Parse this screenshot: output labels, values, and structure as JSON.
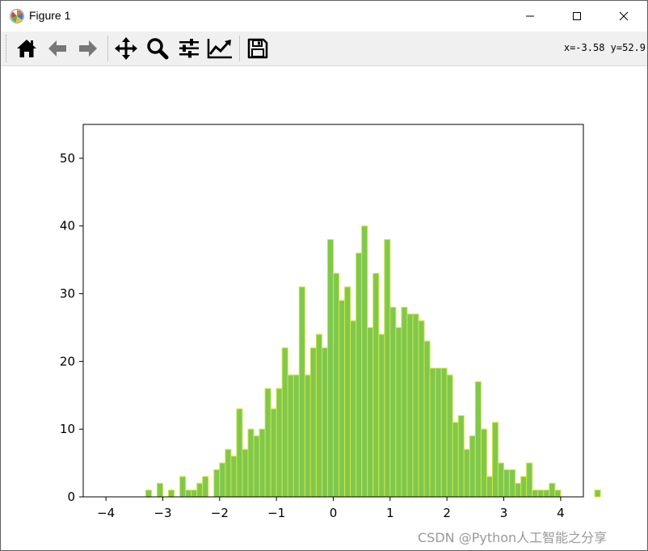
{
  "window": {
    "title": "Figure 1",
    "controls": [
      "minimize",
      "maximize",
      "close"
    ]
  },
  "toolbar": {
    "buttons": [
      {
        "name": "home",
        "icon": "home-icon"
      },
      {
        "name": "back",
        "icon": "arrow-left-icon"
      },
      {
        "name": "forward",
        "icon": "arrow-right-icon"
      },
      {
        "name": "pan",
        "icon": "move-arrows-icon"
      },
      {
        "name": "zoom",
        "icon": "magnifier-icon"
      },
      {
        "name": "subplots",
        "icon": "sliders-icon"
      },
      {
        "name": "edit-axes",
        "icon": "line-chart-icon"
      },
      {
        "name": "save",
        "icon": "floppy-disk-icon"
      }
    ],
    "coordinates": "x=-3.58 y=52.9"
  },
  "chart_data": {
    "type": "bar",
    "x": [
      -3.25,
      -3.15,
      -3.05,
      -2.95,
      -2.85,
      -2.75,
      -2.65,
      -2.55,
      -2.45,
      -2.35,
      -2.25,
      -2.15,
      -2.05,
      -1.95,
      -1.85,
      -1.75,
      -1.65,
      -1.55,
      -1.45,
      -1.35,
      -1.25,
      -1.15,
      -1.05,
      -0.95,
      -0.85,
      -0.75,
      -0.65,
      -0.55,
      -0.45,
      -0.35,
      -0.25,
      -0.15,
      -0.05,
      0.05,
      0.15,
      0.25,
      0.35,
      0.45,
      0.55,
      0.65,
      0.75,
      0.85,
      0.95,
      1.05,
      1.15,
      1.25,
      1.35,
      1.45,
      1.55,
      1.65,
      1.75,
      1.85,
      1.95,
      2.05,
      2.15,
      2.25,
      2.35,
      2.45,
      2.55,
      2.65,
      2.75,
      2.85,
      2.95,
      3.05,
      3.15,
      3.25,
      3.35,
      3.45
    ],
    "values": [
      1,
      0,
      2,
      0,
      1,
      0,
      3,
      1,
      1,
      2,
      3,
      0,
      4,
      5,
      7,
      6,
      13,
      7,
      10,
      9,
      10,
      16,
      13,
      16,
      22,
      18,
      18,
      31,
      18,
      22,
      24,
      22,
      38,
      33,
      29,
      31,
      26,
      36,
      40,
      25,
      33,
      24,
      38,
      28,
      25,
      28,
      27,
      27,
      26,
      23,
      19,
      19,
      19,
      18,
      11,
      12,
      7,
      9,
      17,
      10,
      3,
      11,
      5,
      4,
      4,
      2,
      3,
      5,
      1,
      1,
      1,
      2,
      1,
      0,
      0,
      0,
      0,
      0,
      0,
      1
    ],
    "bins": {
      "start": -3.3,
      "width": 0.1
    },
    "bar_color": "#7ec850",
    "edge_color": "#d4e43a",
    "xlim": [
      -4.4,
      4.4
    ],
    "ylim": [
      0,
      55
    ],
    "xticks": [
      -4,
      -3,
      -2,
      -1,
      0,
      1,
      2,
      3,
      4
    ],
    "xtick_labels": [
      "−4",
      "−3",
      "−2",
      "−1",
      "0",
      "1",
      "2",
      "3",
      "4"
    ],
    "yticks": [
      0,
      10,
      20,
      30,
      40,
      50
    ],
    "title": "",
    "xlabel": "",
    "ylabel": ""
  },
  "watermark": "CSDN @Python人工智能之分享"
}
